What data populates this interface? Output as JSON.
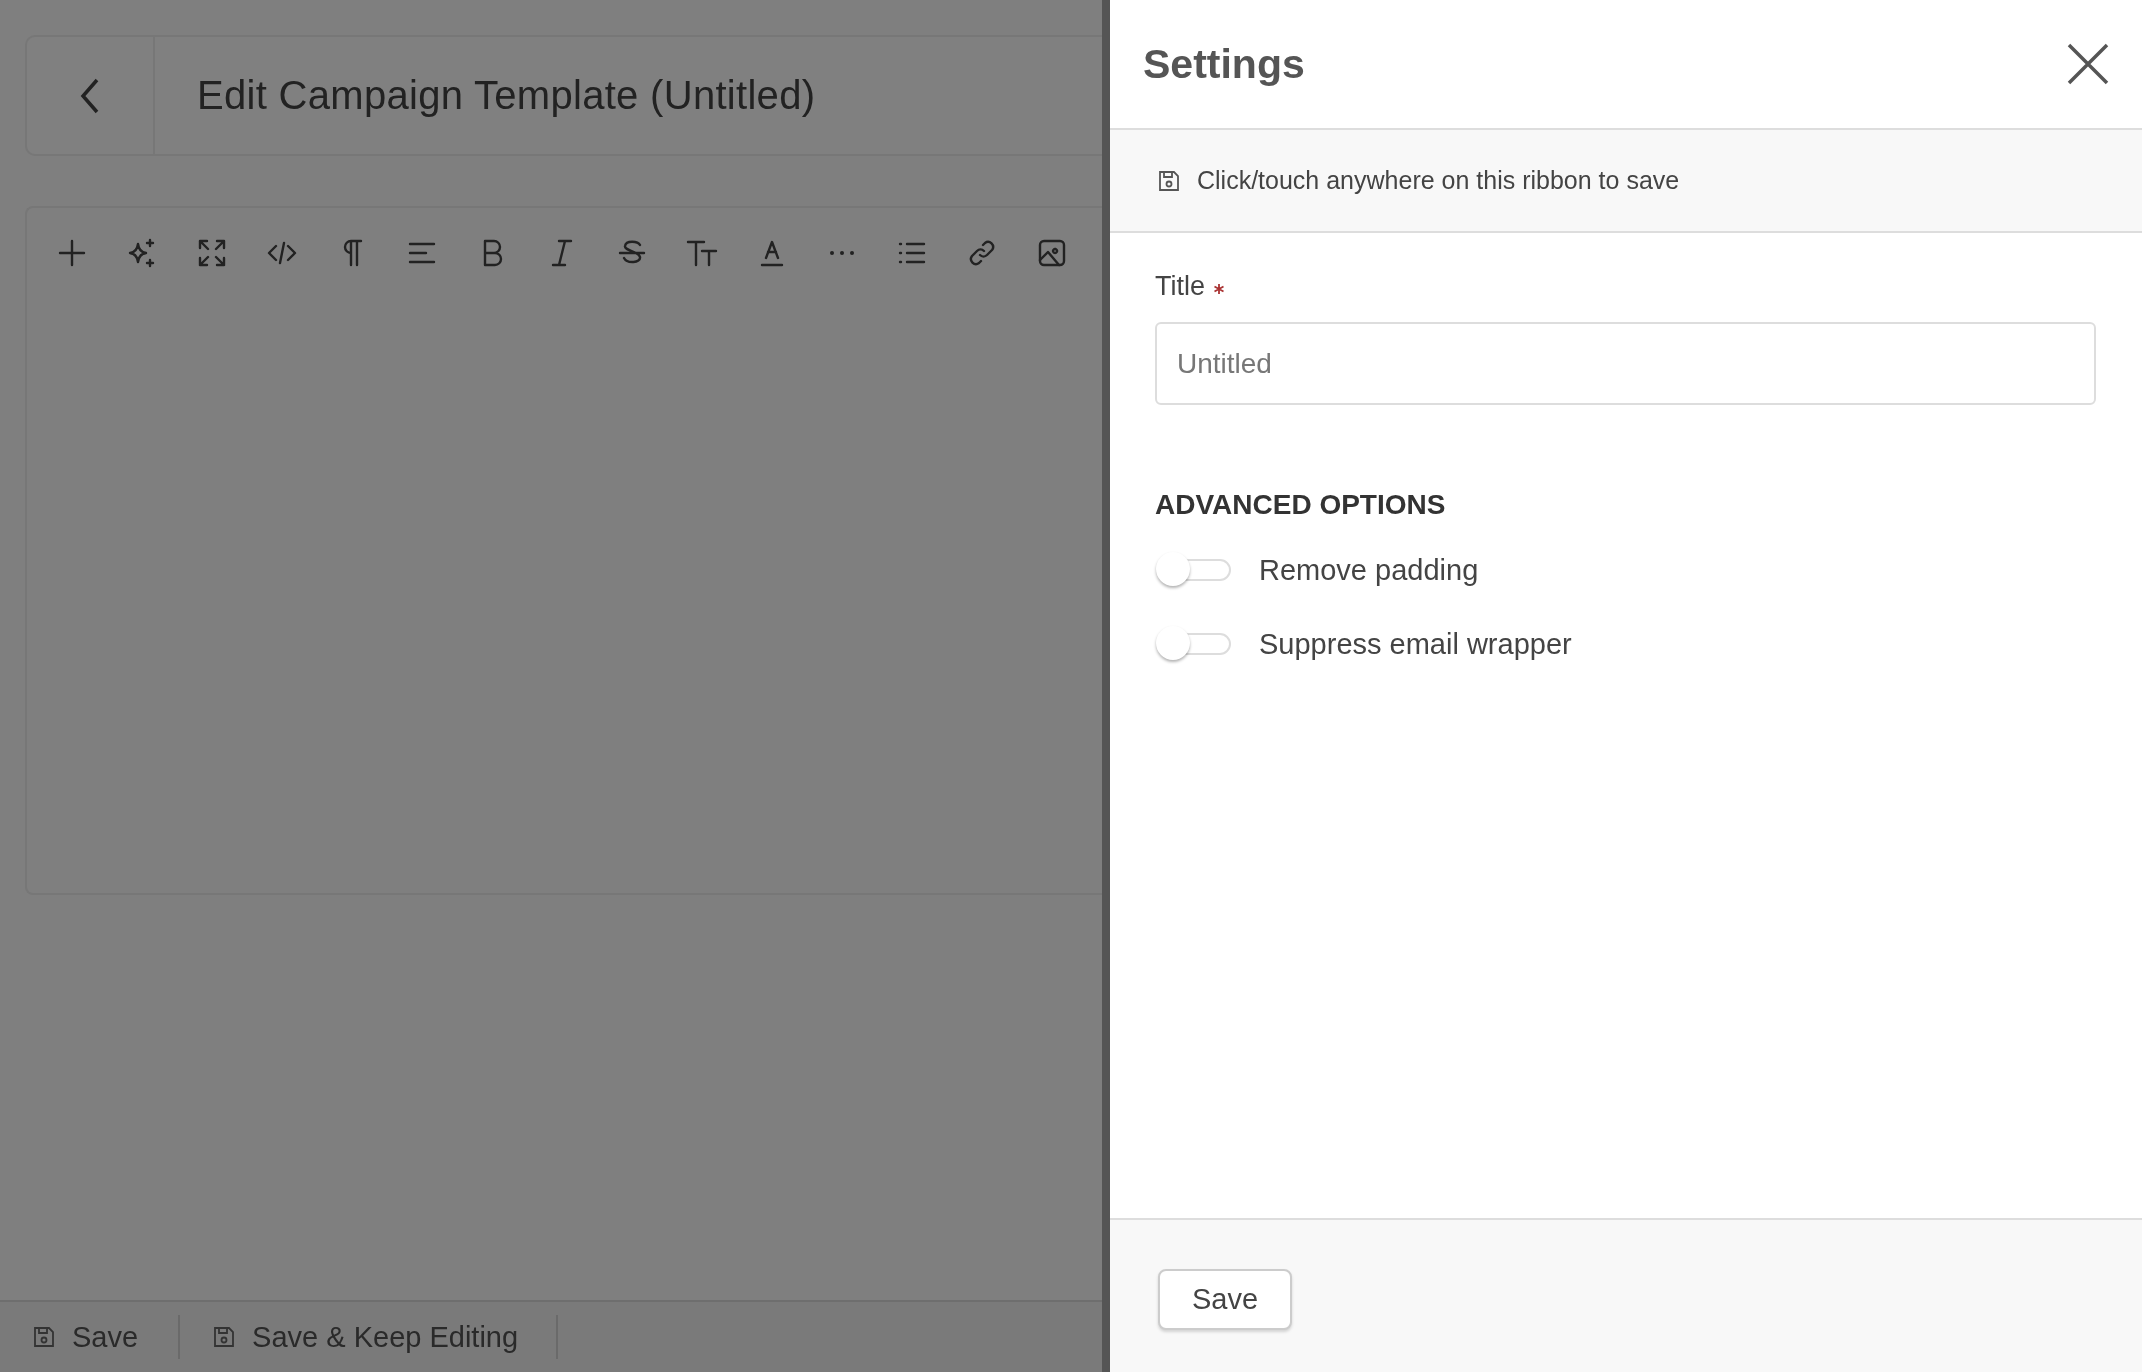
{
  "editor": {
    "title": "Edit Campaign Template (Untitled)"
  },
  "bottom_bar": {
    "buttons": [
      {
        "label": "Save"
      },
      {
        "label": "Save & Keep Editing"
      }
    ]
  },
  "settings_panel": {
    "title": "Settings",
    "ribbon": "Click/touch anywhere on this ribbon to save",
    "title_field": {
      "label": "Title",
      "required": true,
      "placeholder": "Untitled"
    },
    "section_heading": "ADVANCED OPTIONS",
    "toggles": [
      {
        "label": "Remove padding",
        "on": false
      },
      {
        "label": "Suppress email wrapper",
        "on": false
      }
    ],
    "footer_button": "Save"
  }
}
